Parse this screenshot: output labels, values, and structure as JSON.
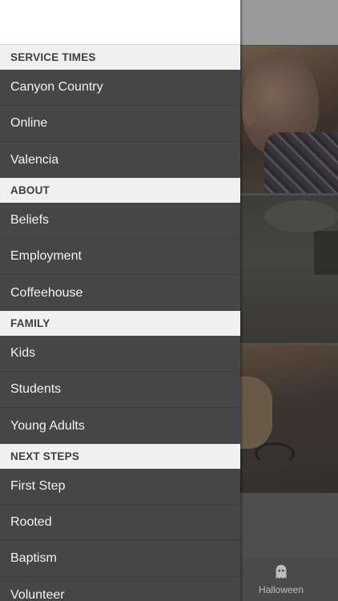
{
  "drawer": {
    "sections": [
      {
        "title": "SERVICE TIMES",
        "items": [
          "Canyon Country",
          "Online",
          "Valencia"
        ]
      },
      {
        "title": "ABOUT",
        "items": [
          "Beliefs",
          "Employment",
          "Coffeehouse"
        ]
      },
      {
        "title": "FAMILY",
        "items": [
          "Kids",
          "Students",
          "Young Adults"
        ]
      },
      {
        "title": "NEXT STEPS",
        "items": [
          "First Step",
          "Rooted",
          "Baptism",
          "Volunteer"
        ]
      }
    ]
  },
  "tabbar": {
    "active_tab": {
      "label": "Halloween",
      "icon": "ghost-icon"
    }
  },
  "colors": {
    "drawer_bg": "#464646",
    "section_header_bg": "#f0f0f0",
    "drawer_header_bg": "#ffffff"
  }
}
